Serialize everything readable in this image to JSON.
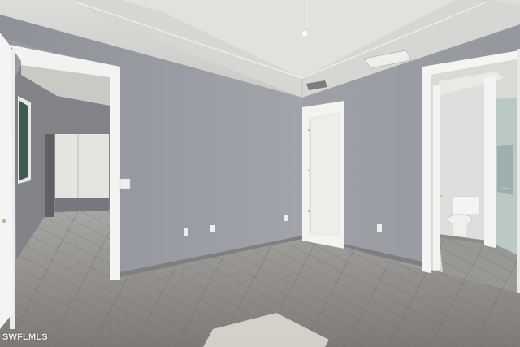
{
  "photo": {
    "watermark": "SWFLMLS"
  },
  "colors": {
    "wall": "#9c9ea6",
    "ceiling": "#cfcfcc",
    "trim": "#f3f3f1",
    "floor": "#8d8a86",
    "doorway_dark": "#5d5f64"
  }
}
